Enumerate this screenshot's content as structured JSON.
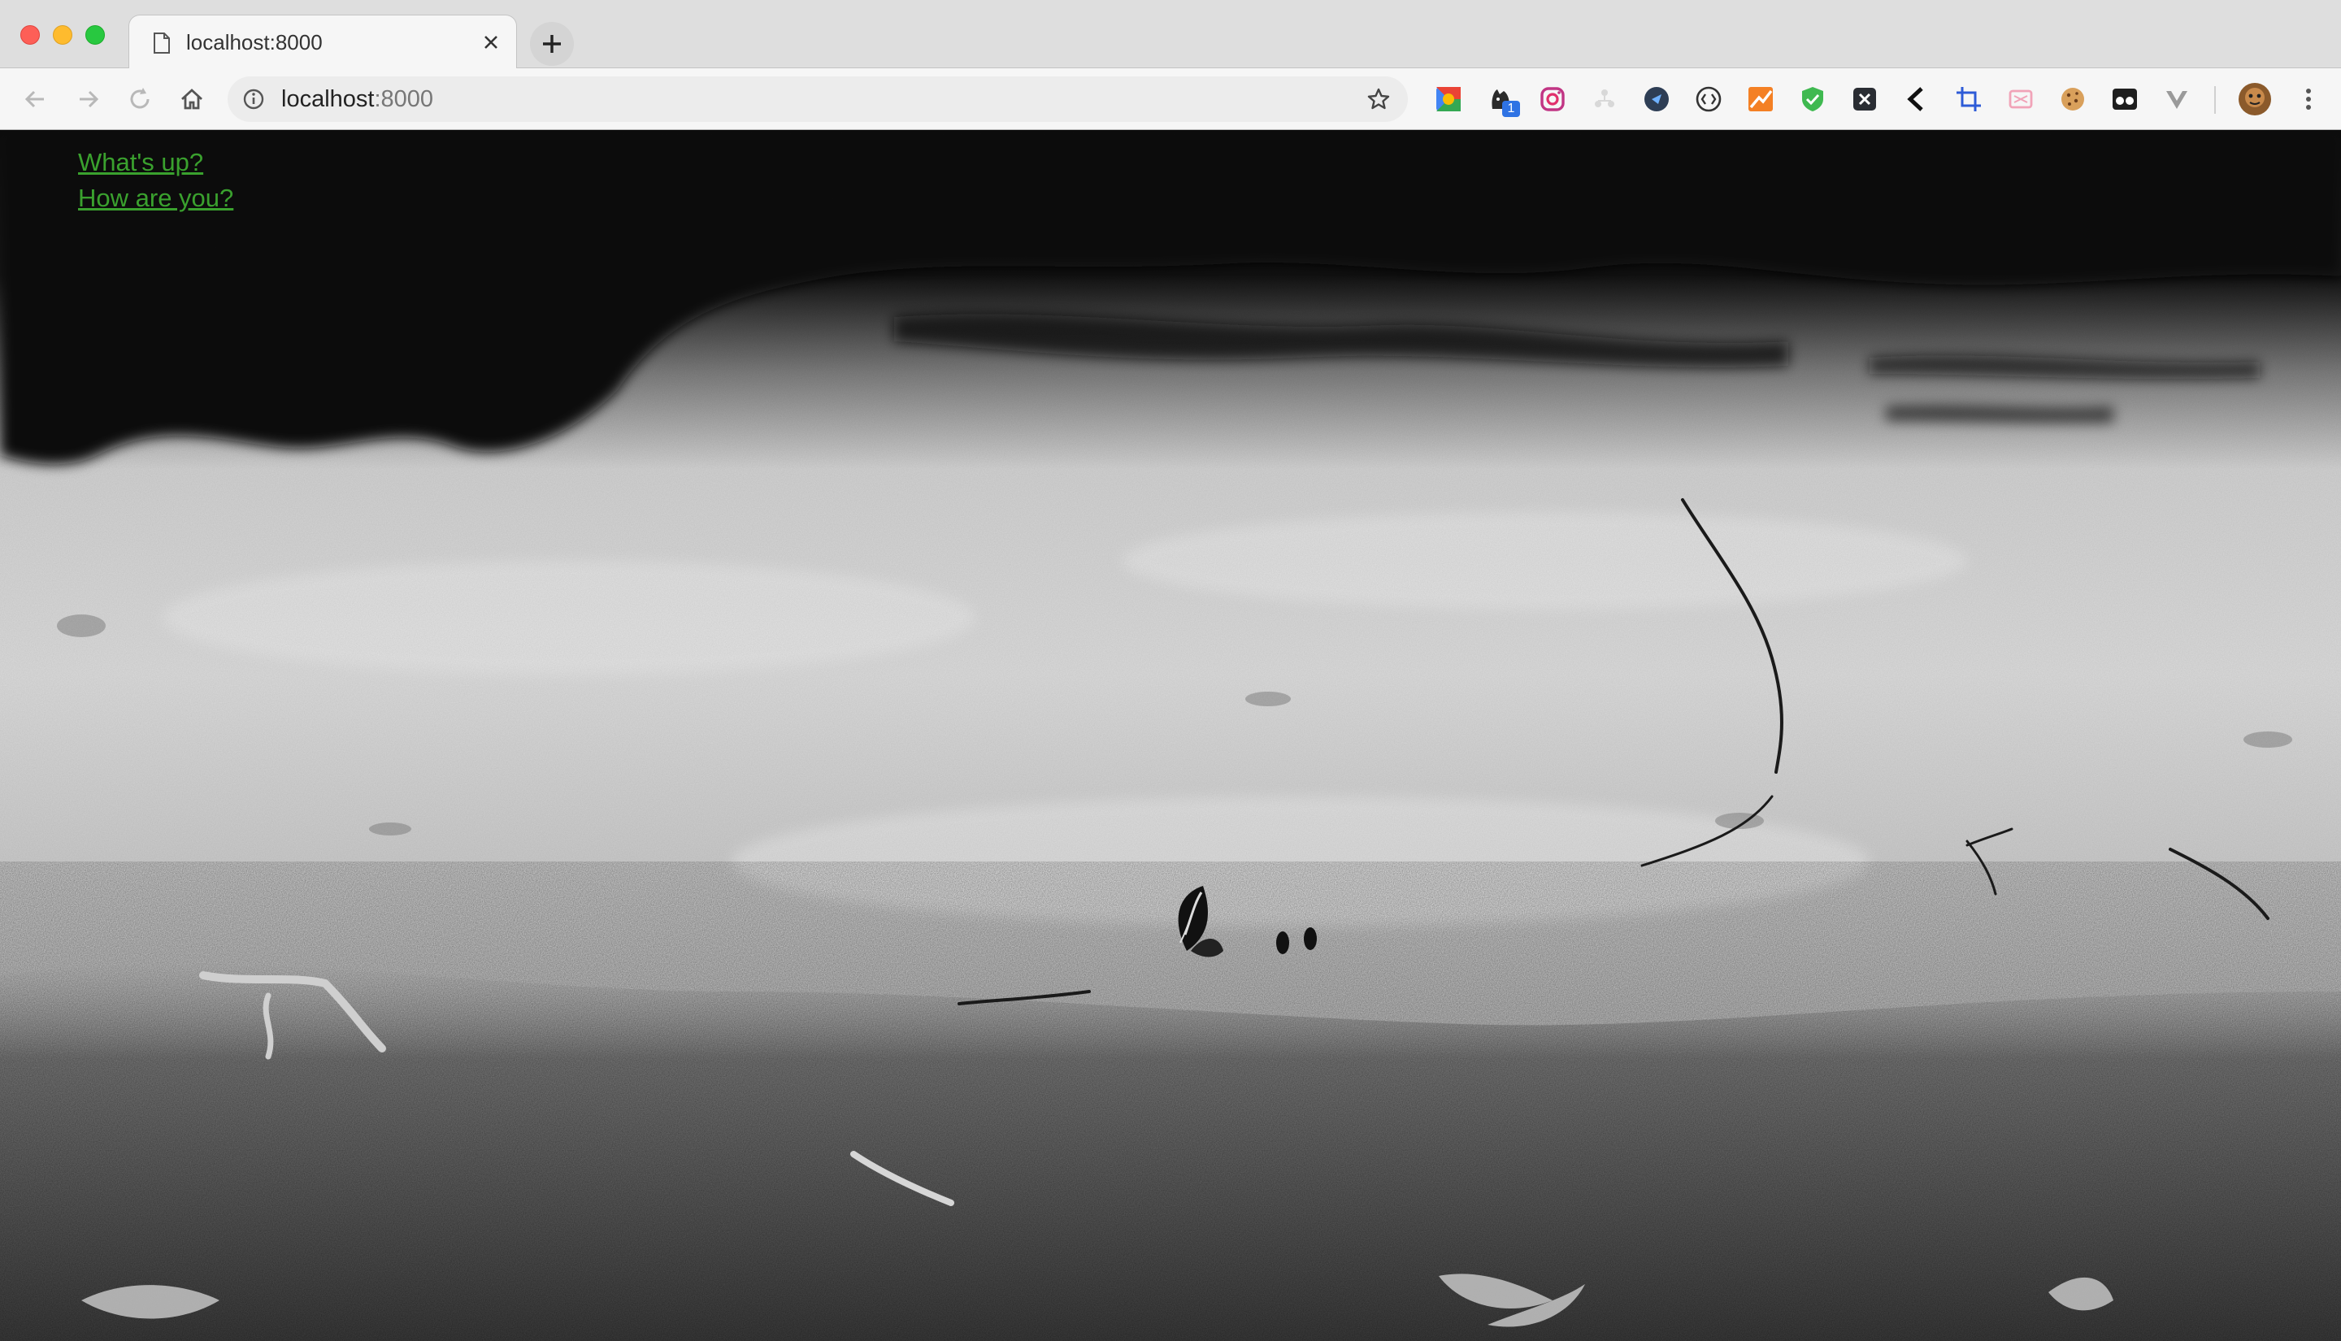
{
  "browser": {
    "tab": {
      "title": "localhost:8000",
      "favicon": "document-icon",
      "close_icon": "close-icon"
    },
    "new_tab_icon": "plus-icon",
    "toolbar": {
      "back_icon": "back-arrow-icon",
      "forward_icon": "forward-arrow-icon",
      "reload_icon": "reload-icon",
      "home_icon": "home-icon"
    },
    "omnibox": {
      "info_icon": "info-icon",
      "host": "localhost",
      "port": ":8000",
      "bookmark_icon": "star-icon"
    },
    "extensions": [
      "google-extension-icon",
      "cat-extension-icon",
      "instagram-extension-icon",
      "tree-extension-icon",
      "blue-circle-extension-icon",
      "code-extension-icon",
      "chart-extension-icon",
      "shield-extension-icon",
      "x-extension-icon",
      "chevron-left-extension-icon",
      "crop-extension-icon",
      "pink-extension-icon",
      "cookie-extension-icon",
      "glasses-extension-icon",
      "v-extension-icon"
    ],
    "extension_badge": "1",
    "profile_icon": "avatar",
    "menu_icon": "kebab-menu-icon"
  },
  "page": {
    "links": [
      "What's up?",
      "How are you?"
    ],
    "link_color": "#3aa12e",
    "background": "black-and-white-photo-of-lakeshore-with-butterfly"
  }
}
